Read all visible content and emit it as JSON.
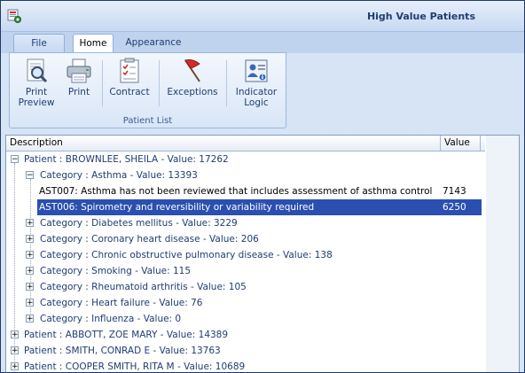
{
  "window": {
    "title": "High Value Patients"
  },
  "tabs": [
    {
      "label": "File"
    },
    {
      "label": "Home"
    },
    {
      "label": "Appearance"
    }
  ],
  "ribbon": {
    "buttons": [
      {
        "label_line1": "Print",
        "label_line2": "Preview",
        "icon": "print-preview-icon"
      },
      {
        "label_line1": "Print",
        "label_line2": "",
        "icon": "printer-icon"
      },
      {
        "label_line1": "Contract",
        "label_line2": "",
        "icon": "contract-icon"
      },
      {
        "label_line1": "Exceptions",
        "label_line2": "",
        "icon": "flag-icon"
      },
      {
        "label_line1": "Indicator",
        "label_line2": "Logic",
        "icon": "indicator-logic-icon"
      }
    ],
    "group_label": "Patient List"
  },
  "grid": {
    "columns": {
      "description": "Description",
      "value": "Value"
    },
    "rows": [
      {
        "text": "Patient : BROWNLEE, SHEILA - Value: 17262",
        "value": "",
        "expander": "−"
      },
      {
        "text": "Category : Asthma - Value: 13393",
        "value": "",
        "expander": "−"
      },
      {
        "text": "AST007: Asthma has not been reviewed that includes assessment of asthma control",
        "value": "7143",
        "expander": ""
      },
      {
        "text": "AST006: Spirometry and reversibility or variability required",
        "value": "6250",
        "expander": ""
      },
      {
        "text": "Category : Diabetes mellitus - Value: 3229",
        "value": "",
        "expander": "+"
      },
      {
        "text": "Category : Coronary heart disease - Value: 206",
        "value": "",
        "expander": "+"
      },
      {
        "text": "Category : Chronic obstructive pulmonary disease - Value: 138",
        "value": "",
        "expander": "+"
      },
      {
        "text": "Category : Smoking - Value: 115",
        "value": "",
        "expander": "+"
      },
      {
        "text": "Category : Rheumatoid arthritis - Value: 105",
        "value": "",
        "expander": "+"
      },
      {
        "text": "Category : Heart failure - Value: 76",
        "value": "",
        "expander": "+"
      },
      {
        "text": "Category : Influenza - Value: 0",
        "value": "",
        "expander": "+"
      },
      {
        "text": "Patient : ABBOTT, ZOE MARY - Value: 14389",
        "value": "",
        "expander": "+"
      },
      {
        "text": "Patient : SMITH, CONRAD E - Value: 13763",
        "value": "",
        "expander": "+"
      },
      {
        "text": "Patient : COOPER SMITH, RITA M - Value: 10689",
        "value": "",
        "expander": "+"
      }
    ]
  }
}
